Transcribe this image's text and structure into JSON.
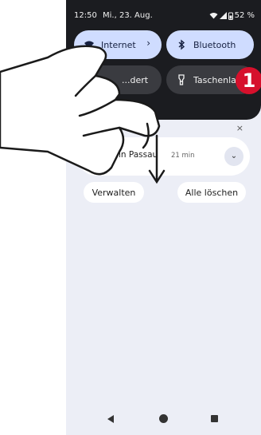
{
  "status_bar": {
    "time": "12:50",
    "date": "Mi., 23. Aug.",
    "battery": "52 %"
  },
  "quick_settings": {
    "tiles": [
      {
        "label": "Internet",
        "icon": "wifi-icon",
        "active": true
      },
      {
        "label": "Bluetooth",
        "icon": "bluetooth-icon",
        "active": true
      },
      {
        "label": "...dert",
        "icon": "moon-icon",
        "active": false
      },
      {
        "label": "Taschenla...",
        "icon": "flashlight-icon",
        "active": false
      }
    ],
    "chevron": "›"
  },
  "notification": {
    "title": "27° in Passau",
    "time": "21 min",
    "close_symbol": "×",
    "expand_symbol": "⌄"
  },
  "buttons": {
    "manage": "Verwalten",
    "clear_all": "Alle löschen"
  },
  "badge": {
    "number": "1",
    "color": "#d6102c"
  },
  "colors": {
    "active_tile": "#cfdcff",
    "inactive_tile": "#3a3b40",
    "panel_bg": "#1b1c20",
    "shade_bg": "#eceef6"
  }
}
